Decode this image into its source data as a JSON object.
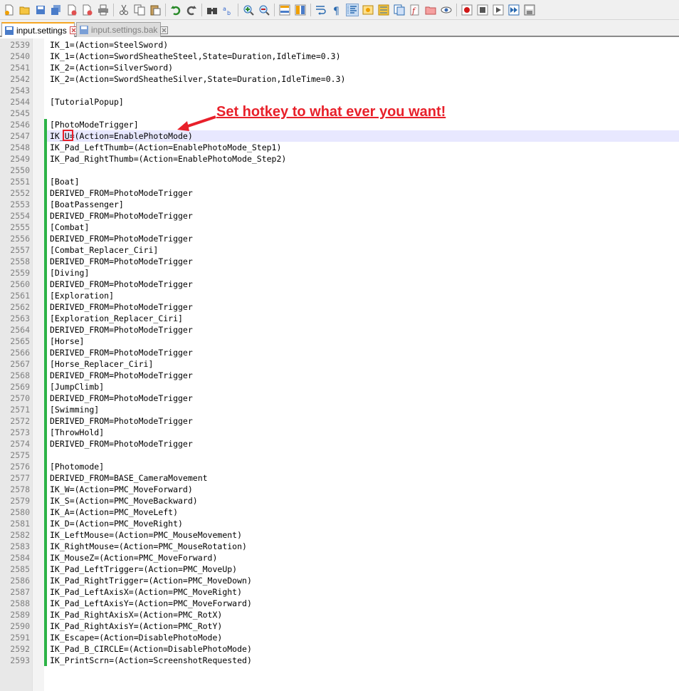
{
  "toolbar": {
    "icons": [
      "new-file-icon",
      "open-file-icon",
      "save-icon",
      "save-all-icon",
      "close-icon",
      "close-all-icon",
      "print-icon",
      "cut-icon",
      "copy-icon",
      "paste-icon",
      "undo-icon",
      "redo-icon",
      "find-icon",
      "replace-icon",
      "zoom-in-icon",
      "zoom-out-icon",
      "sync-vertical-icon",
      "sync-horizontal-icon",
      "word-wrap-icon",
      "show-all-chars-icon",
      "indent-guide-icon",
      "language-icon",
      "doc-map-icon",
      "function-list-icon",
      "folder-workspace-icon",
      "monitoring-icon",
      "record-macro-icon",
      "stop-macro-icon",
      "play-macro-icon",
      "run-macro-multiple-icon",
      "save-macro-icon"
    ]
  },
  "tabs": [
    {
      "label": "input.settings",
      "active": true
    },
    {
      "label": "input.settings.bak",
      "active": false
    }
  ],
  "annotation": "Set hotkey to what ever you want!",
  "colors": {
    "accent_red": "#e8202a",
    "change_bar": "#2db347",
    "current_line": "#e8e8ff"
  },
  "lines": [
    {
      "n": "2539",
      "t": "IK_1=(Action=SteelSword)"
    },
    {
      "n": "2540",
      "t": "IK_1=(Action=SwordSheatheSteel,State=Duration,IdleTime=0.3)"
    },
    {
      "n": "2541",
      "t": "IK_2=(Action=SilverSword)"
    },
    {
      "n": "2542",
      "t": "IK_2=(Action=SwordSheatheSilver,State=Duration,IdleTime=0.3)"
    },
    {
      "n": "2543",
      "t": ""
    },
    {
      "n": "2544",
      "t": "[TutorialPopup]"
    },
    {
      "n": "2545",
      "t": ""
    },
    {
      "n": "2546",
      "t": "[PhotoModeTrigger]"
    },
    {
      "n": "2547",
      "t": "IK_U=(Action=EnablePhotoMode)"
    },
    {
      "n": "2548",
      "t": "IK_Pad_LeftThumb=(Action=EnablePhotoMode_Step1)"
    },
    {
      "n": "2549",
      "t": "IK_Pad_RightThumb=(Action=EnablePhotoMode_Step2)"
    },
    {
      "n": "2550",
      "t": ""
    },
    {
      "n": "2551",
      "t": "[Boat]"
    },
    {
      "n": "2552",
      "t": "DERIVED_FROM=PhotoModeTrigger"
    },
    {
      "n": "2553",
      "t": "[BoatPassenger]"
    },
    {
      "n": "2554",
      "t": "DERIVED_FROM=PhotoModeTrigger"
    },
    {
      "n": "2555",
      "t": "[Combat]"
    },
    {
      "n": "2556",
      "t": "DERIVED_FROM=PhotoModeTrigger"
    },
    {
      "n": "2557",
      "t": "[Combat_Replacer_Ciri]"
    },
    {
      "n": "2558",
      "t": "DERIVED_FROM=PhotoModeTrigger"
    },
    {
      "n": "2559",
      "t": "[Diving]"
    },
    {
      "n": "2560",
      "t": "DERIVED_FROM=PhotoModeTrigger"
    },
    {
      "n": "2561",
      "t": "[Exploration]"
    },
    {
      "n": "2562",
      "t": "DERIVED_FROM=PhotoModeTrigger"
    },
    {
      "n": "2563",
      "t": "[Exploration_Replacer_Ciri]"
    },
    {
      "n": "2564",
      "t": "DERIVED_FROM=PhotoModeTrigger"
    },
    {
      "n": "2565",
      "t": "[Horse]"
    },
    {
      "n": "2566",
      "t": "DERIVED_FROM=PhotoModeTrigger"
    },
    {
      "n": "2567",
      "t": "[Horse_Replacer_Ciri]"
    },
    {
      "n": "2568",
      "t": "DERIVED_FROM=PhotoModeTrigger"
    },
    {
      "n": "2569",
      "t": "[JumpClimb]"
    },
    {
      "n": "2570",
      "t": "DERIVED_FROM=PhotoModeTrigger"
    },
    {
      "n": "2571",
      "t": "[Swimming]"
    },
    {
      "n": "2572",
      "t": "DERIVED_FROM=PhotoModeTrigger"
    },
    {
      "n": "2573",
      "t": "[ThrowHold]"
    },
    {
      "n": "2574",
      "t": "DERIVED_FROM=PhotoModeTrigger"
    },
    {
      "n": "2575",
      "t": ""
    },
    {
      "n": "2576",
      "t": "[Photomode]"
    },
    {
      "n": "2577",
      "t": "DERIVED_FROM=BASE_CameraMovement"
    },
    {
      "n": "2578",
      "t": "IK_W=(Action=PMC_MoveForward)"
    },
    {
      "n": "2579",
      "t": "IK_S=(Action=PMC_MoveBackward)"
    },
    {
      "n": "2580",
      "t": "IK_A=(Action=PMC_MoveLeft)"
    },
    {
      "n": "2581",
      "t": "IK_D=(Action=PMC_MoveRight)"
    },
    {
      "n": "2582",
      "t": "IK_LeftMouse=(Action=PMC_MouseMovement)"
    },
    {
      "n": "2583",
      "t": "IK_RightMouse=(Action=PMC_MouseRotation)"
    },
    {
      "n": "2584",
      "t": "IK_MouseZ=(Action=PMC_MoveForward)"
    },
    {
      "n": "2585",
      "t": "IK_Pad_LeftTrigger=(Action=PMC_MoveUp)"
    },
    {
      "n": "2586",
      "t": "IK_Pad_RightTrigger=(Action=PMC_MoveDown)"
    },
    {
      "n": "2587",
      "t": "IK_Pad_LeftAxisX=(Action=PMC_MoveRight)"
    },
    {
      "n": "2588",
      "t": "IK_Pad_LeftAxisY=(Action=PMC_MoveForward)"
    },
    {
      "n": "2589",
      "t": "IK_Pad_RightAxisX=(Action=PMC_RotX)"
    },
    {
      "n": "2590",
      "t": "IK_Pad_RightAxisY=(Action=PMC_RotY)"
    },
    {
      "n": "2591",
      "t": "IK_Escape=(Action=DisablePhotoMode)"
    },
    {
      "n": "2592",
      "t": "IK_Pad_B_CIRCLE=(Action=DisablePhotoMode)"
    },
    {
      "n": "2593",
      "t": "IK_PrintScrn=(Action=ScreenshotRequested)"
    }
  ]
}
